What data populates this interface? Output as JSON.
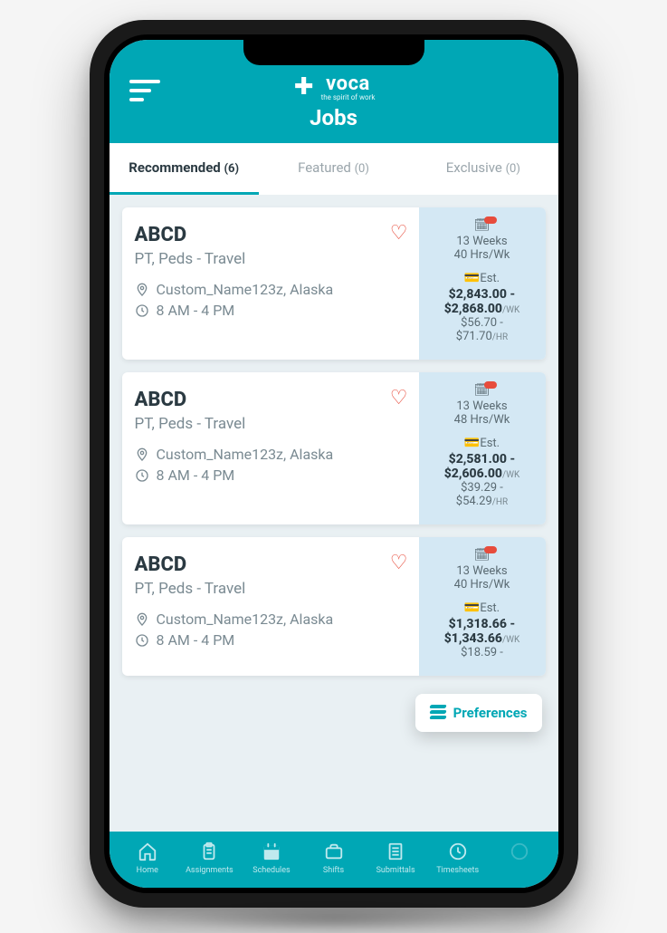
{
  "brand": {
    "name": "voca",
    "tagline": "the spirit of work"
  },
  "page_title": "Jobs",
  "tabs": [
    {
      "label": "Recommended",
      "count": "(6)",
      "active": true
    },
    {
      "label": "Featured",
      "count": "(0)",
      "active": false
    },
    {
      "label": "Exclusive",
      "count": "(0)",
      "active": false
    }
  ],
  "jobs": [
    {
      "title": "ABCD",
      "subtitle": "PT, Peds - Travel",
      "location": "Custom_Name123z, Alaska",
      "hours": "8 AM - 4 PM",
      "duration": "13 Weeks",
      "schedule": "40 Hrs/Wk",
      "est_label": "Est.",
      "wk_low": "$2,843.00",
      "wk_high": "$2,868.00",
      "wk_unit": "/WK",
      "hr_low": "$56.70",
      "hr_high": "$71.70",
      "hr_unit": "/HR"
    },
    {
      "title": "ABCD",
      "subtitle": "PT, Peds - Travel",
      "location": "Custom_Name123z, Alaska",
      "hours": "8 AM - 4 PM",
      "duration": "13 Weeks",
      "schedule": "48 Hrs/Wk",
      "est_label": "Est.",
      "wk_low": "$2,581.00",
      "wk_high": "$2,606.00",
      "wk_unit": "/WK",
      "hr_low": "$39.29",
      "hr_high": "$54.29",
      "hr_unit": "/HR"
    },
    {
      "title": "ABCD",
      "subtitle": "PT, Peds - Travel",
      "location": "Custom_Name123z, Alaska",
      "hours": "8 AM - 4 PM",
      "duration": "13 Weeks",
      "schedule": "40 Hrs/Wk",
      "est_label": "Est.",
      "wk_low": "$1,318.66",
      "wk_high": "$1,343.66",
      "wk_unit": "/WK",
      "hr_low": "$18.59",
      "hr_high": "",
      "hr_unit": ""
    }
  ],
  "preferences_label": "Preferences",
  "bottom_nav": [
    {
      "icon": "home",
      "label": "Home"
    },
    {
      "icon": "assignments",
      "label": "Assignments"
    },
    {
      "icon": "schedules",
      "label": "Schedules"
    },
    {
      "icon": "shifts",
      "label": "Shifts"
    },
    {
      "icon": "submittals",
      "label": "Submittals"
    },
    {
      "icon": "timesheets",
      "label": "Timesheets"
    }
  ]
}
